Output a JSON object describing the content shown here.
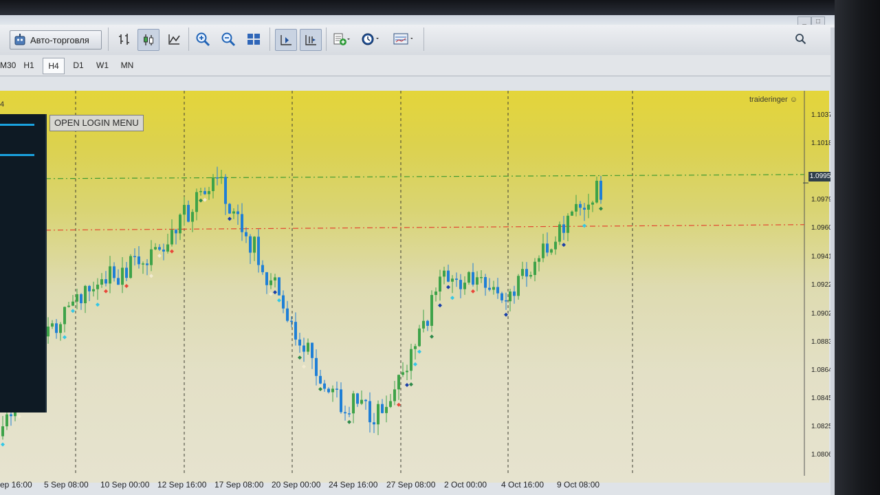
{
  "window": {
    "minimize": "_",
    "restore": "□",
    "close": "×"
  },
  "toolbar": {
    "autotrade_label": "Авто-торговля",
    "buttons": [
      {
        "name": "bar-chart-icon"
      },
      {
        "name": "candlestick-icon"
      },
      {
        "name": "line-chart-icon"
      },
      {
        "name": "zoom-in-icon"
      },
      {
        "name": "zoom-out-icon"
      },
      {
        "name": "tile-windows-icon"
      },
      {
        "name": "chart-shift-icon"
      },
      {
        "name": "autoscroll-icon"
      },
      {
        "name": "indicators-icon"
      },
      {
        "name": "periods-icon"
      },
      {
        "name": "templates-icon"
      }
    ]
  },
  "timeframes": [
    "M30",
    "H1",
    "H4",
    "D1",
    "W1",
    "MN"
  ],
  "active_timeframe": "H4",
  "chart": {
    "corner_label": "4",
    "login_button": "OPEN LOGIN MENU",
    "watermark": "traideringer",
    "current_price": "1.0995",
    "price_ticks": [
      "1.1037",
      "1.1018",
      "1.0979",
      "1.0960",
      "1.0941",
      "1.0922",
      "1.0902",
      "1.0883",
      "1.0864",
      "1.0845",
      "1.0825",
      "1.0806"
    ],
    "time_labels": [
      "ep 16:00",
      "5 Sep 08:00",
      "10 Sep 00:00",
      "12 Sep 16:00",
      "17 Sep 08:00",
      "20 Sep 00:00",
      "24 Sep 16:00",
      "27 Sep 08:00",
      "2 Oct 00:00",
      "4 Oct 16:00",
      "9 Oct 08:00"
    ],
    "colors": {
      "bull": "#3ea349",
      "bear": "#1f7fd6",
      "support": "#e2452f",
      "resistance": "#3f9a2f"
    }
  },
  "chart_data": {
    "type": "line",
    "title": "",
    "xlabel": "",
    "ylabel": "",
    "ylim": [
      1.08,
      1.1045
    ],
    "x": [
      "ep 16:00",
      "5 Sep 08:00",
      "10 Sep 00:00",
      "12 Sep 16:00",
      "17 Sep 08:00",
      "20 Sep 00:00",
      "24 Sep 16:00",
      "27 Sep 08:00",
      "2 Oct 00:00",
      "4 Oct 16:00",
      "9 Oct 08:00"
    ],
    "series": [
      {
        "values": [
          1.0818,
          1.0888,
          1.0925,
          1.0948,
          1.1002,
          1.0925,
          1.0845,
          1.0832,
          1.0932,
          1.0915,
          1.0995
        ]
      }
    ],
    "horizontal_levels": [
      1.0998,
      1.0962
    ],
    "current_price": 1.0995
  }
}
